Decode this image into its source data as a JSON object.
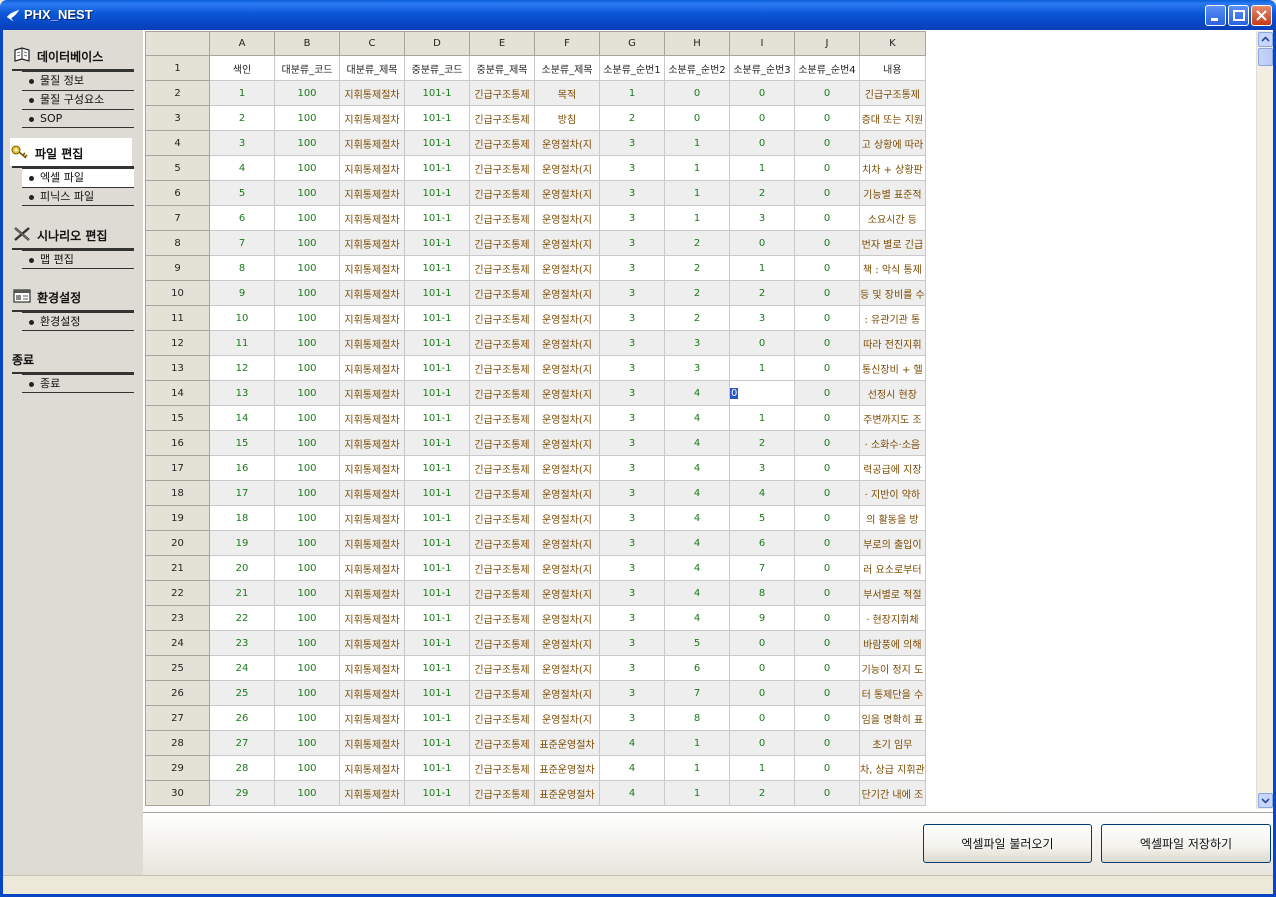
{
  "window": {
    "title": "PHX_NEST"
  },
  "sidebar": {
    "groups": [
      {
        "label": "데이터베이스",
        "icon": "database-book-icon",
        "items": [
          "물질 정보",
          "물질 구성요소",
          "SOP"
        ]
      },
      {
        "label": "파일 편집",
        "icon": "key-icon",
        "items": [
          "엑셀 파일",
          "피닉스 파일"
        ]
      },
      {
        "label": "시나리오 편집",
        "icon": "scenario-x-icon",
        "items": [
          "맵 편집"
        ]
      },
      {
        "label": "환경설정",
        "icon": "settings-window-icon",
        "items": [
          "환경설정"
        ]
      },
      {
        "label": "종료",
        "icon": "",
        "items": [
          "종료"
        ]
      }
    ]
  },
  "sheet": {
    "columns": [
      "A",
      "B",
      "C",
      "D",
      "E",
      "F",
      "G",
      "H",
      "I",
      "J",
      "K"
    ],
    "header_row": [
      "색인",
      "대분류_코드",
      "대분류_제목",
      "중분류_코드",
      "중분류_제목",
      "소분류_제목",
      "소분류_순번1",
      "소분류_순번2",
      "소분류_순번3",
      "소분류_순번4",
      "내용"
    ],
    "rows": [
      [
        "1",
        "100",
        "지휘통제절차",
        "101-1",
        "긴급구조통제",
        "목적",
        "1",
        "0",
        "0",
        "0",
        "긴급구조통제"
      ],
      [
        "2",
        "100",
        "지휘통제절차",
        "101-1",
        "긴급구조통제",
        "방침",
        "2",
        "0",
        "0",
        "0",
        "증대 또는 지원"
      ],
      [
        "3",
        "100",
        "지휘통제절차",
        "101-1",
        "긴급구조통제",
        "운영절차(지",
        "3",
        "1",
        "0",
        "0",
        "고 상황에 따라"
      ],
      [
        "4",
        "100",
        "지휘통제절차",
        "101-1",
        "긴급구조통제",
        "운영절차(지",
        "3",
        "1",
        "1",
        "0",
        "치차 + 상황판"
      ],
      [
        "5",
        "100",
        "지휘통제절차",
        "101-1",
        "긴급구조통제",
        "운영절차(지",
        "3",
        "1",
        "2",
        "0",
        "기능별 표준적"
      ],
      [
        "6",
        "100",
        "지휘통제절차",
        "101-1",
        "긴급구조통제",
        "운영절차(지",
        "3",
        "1",
        "3",
        "0",
        "소요시간 등"
      ],
      [
        "7",
        "100",
        "지휘통제절차",
        "101-1",
        "긴급구조통제",
        "운영절차(지",
        "3",
        "2",
        "0",
        "0",
        "번자 별로 긴급"
      ],
      [
        "8",
        "100",
        "지휘통제절차",
        "101-1",
        "긴급구조통제",
        "운영절차(지",
        "3",
        "2",
        "1",
        "0",
        "책 : 악식 통제"
      ],
      [
        "9",
        "100",
        "지휘통제절차",
        "101-1",
        "긴급구조통제",
        "운영절차(지",
        "3",
        "2",
        "2",
        "0",
        "등 및 장비를 수"
      ],
      [
        "10",
        "100",
        "지휘통제절차",
        "101-1",
        "긴급구조통제",
        "운영절차(지",
        "3",
        "2",
        "3",
        "0",
        ": 유관기관 통"
      ],
      [
        "11",
        "100",
        "지휘통제절차",
        "101-1",
        "긴급구조통제",
        "운영절차(지",
        "3",
        "3",
        "0",
        "0",
        "따라 전진지휘"
      ],
      [
        "12",
        "100",
        "지휘통제절차",
        "101-1",
        "긴급구조통제",
        "운영절차(지",
        "3",
        "3",
        "1",
        "0",
        "통신장비 + 헬"
      ],
      [
        "13",
        "100",
        "지휘통제절차",
        "101-1",
        "긴급구조통제",
        "운영절차(지",
        "3",
        "4",
        "0",
        "0",
        "선정시 현장"
      ],
      [
        "14",
        "100",
        "지휘통제절차",
        "101-1",
        "긴급구조통제",
        "운영절차(지",
        "3",
        "4",
        "1",
        "0",
        "주변까지도 조"
      ],
      [
        "15",
        "100",
        "지휘통제절차",
        "101-1",
        "긴급구조통제",
        "운영절차(지",
        "3",
        "4",
        "2",
        "0",
        "· 소화수·소음"
      ],
      [
        "16",
        "100",
        "지휘통제절차",
        "101-1",
        "긴급구조통제",
        "운영절차(지",
        "3",
        "4",
        "3",
        "0",
        "력공급에 지장"
      ],
      [
        "17",
        "100",
        "지휘통제절차",
        "101-1",
        "긴급구조통제",
        "운영절차(지",
        "3",
        "4",
        "4",
        "0",
        "· 지반이 약하"
      ],
      [
        "18",
        "100",
        "지휘통제절차",
        "101-1",
        "긴급구조통제",
        "운영절차(지",
        "3",
        "4",
        "5",
        "0",
        "의 활동을 방"
      ],
      [
        "19",
        "100",
        "지휘통제절차",
        "101-1",
        "긴급구조통제",
        "운영절차(지",
        "3",
        "4",
        "6",
        "0",
        "부로의 출입이"
      ],
      [
        "20",
        "100",
        "지휘통제절차",
        "101-1",
        "긴급구조통제",
        "운영절차(지",
        "3",
        "4",
        "7",
        "0",
        "러 요소로부터"
      ],
      [
        "21",
        "100",
        "지휘통제절차",
        "101-1",
        "긴급구조통제",
        "운영절차(지",
        "3",
        "4",
        "8",
        "0",
        "부서별로 적절"
      ],
      [
        "22",
        "100",
        "지휘통제절차",
        "101-1",
        "긴급구조통제",
        "운영절차(지",
        "3",
        "4",
        "9",
        "0",
        "· 현장지휘체"
      ],
      [
        "23",
        "100",
        "지휘통제절차",
        "101-1",
        "긴급구조통제",
        "운영절차(지",
        "3",
        "5",
        "0",
        "0",
        "바람풍에 의해"
      ],
      [
        "24",
        "100",
        "지휘통제절차",
        "101-1",
        "긴급구조통제",
        "운영절차(지",
        "3",
        "6",
        "0",
        "0",
        "기능이 정지 도"
      ],
      [
        "25",
        "100",
        "지휘통제절차",
        "101-1",
        "긴급구조통제",
        "운영절차(지",
        "3",
        "7",
        "0",
        "0",
        "터 통제단을 수"
      ],
      [
        "26",
        "100",
        "지휘통제절차",
        "101-1",
        "긴급구조통제",
        "운영절차(지",
        "3",
        "8",
        "0",
        "0",
        "임을 명확히 표"
      ],
      [
        "27",
        "100",
        "지휘통제절차",
        "101-1",
        "긴급구조통제",
        "표준운영절차",
        "4",
        "1",
        "0",
        "0",
        "초기 임무"
      ],
      [
        "28",
        "100",
        "지휘통제절차",
        "101-1",
        "긴급구조통제",
        "표준운영절차",
        "4",
        "1",
        "1",
        "0",
        "차, 상급 지휘관"
      ],
      [
        "29",
        "100",
        "지휘통제절차",
        "101-1",
        "긴급구조통제",
        "표준운영절차",
        "4",
        "1",
        "2",
        "0",
        "단기간 내에 조"
      ]
    ],
    "row_numbers": [
      "2",
      "3",
      "4",
      "5",
      "6",
      "7",
      "8",
      "9",
      "10",
      "11",
      "12",
      "13",
      "14",
      "15",
      "16",
      "17",
      "18",
      "19",
      "20",
      "21",
      "22",
      "23",
      "24",
      "25",
      "26",
      "27",
      "28",
      "29",
      "30"
    ],
    "selected_cell_value": "0"
  },
  "buttons": {
    "load": "엑셀파일 불러오기",
    "save": "엑셀파일 저장하기"
  }
}
